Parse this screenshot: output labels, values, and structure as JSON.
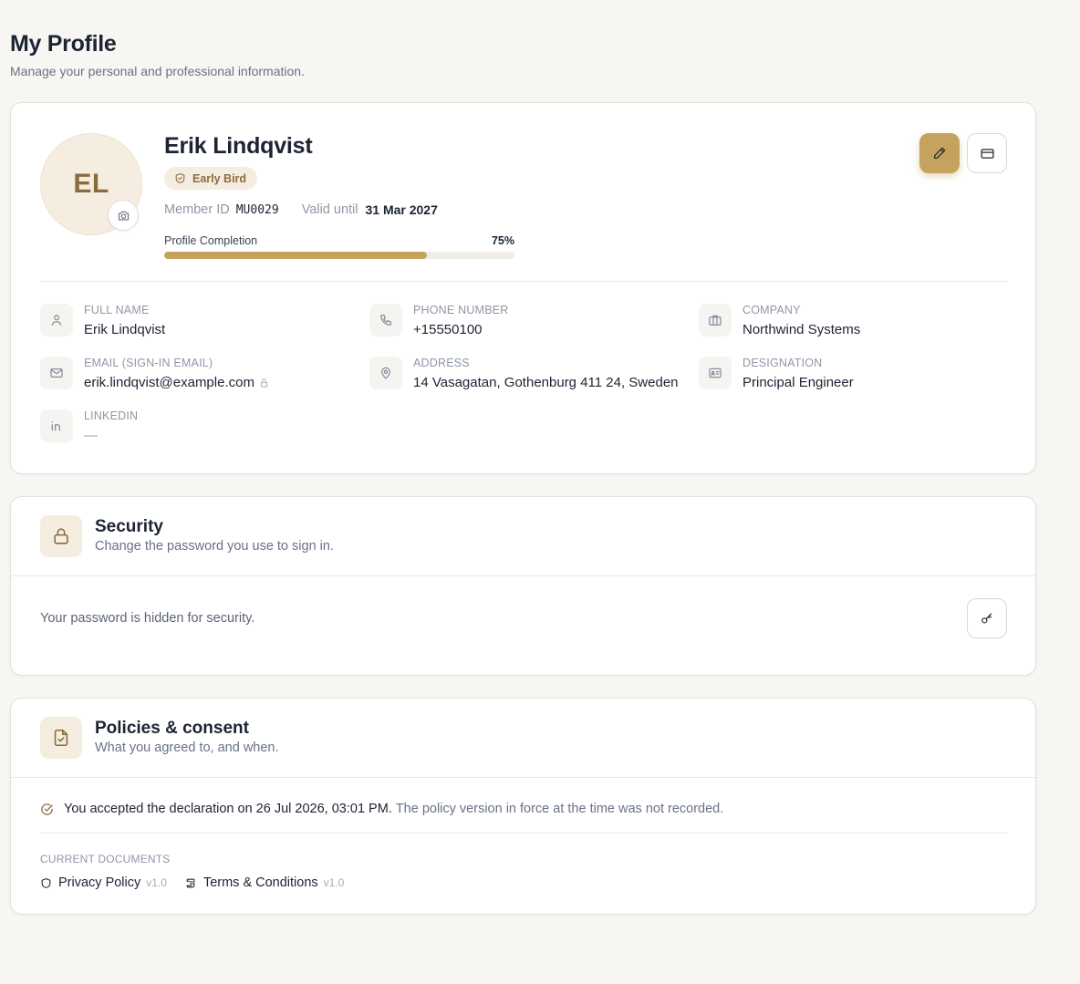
{
  "page": {
    "title": "My Profile",
    "subtitle": "Manage your personal and professional information."
  },
  "profile": {
    "initials": "EL",
    "name": "Erik Lindqvist",
    "badge": "Early Bird",
    "member_id_label": "Member ID",
    "member_id": "MU0029",
    "valid_until_label": "Valid until",
    "valid_until": "31 Mar 2027",
    "completion_label": "Profile Completion",
    "completion_text": "75%",
    "completion_value": 0.75,
    "fields": {
      "full_name": {
        "label": "FULL NAME",
        "value": "Erik Lindqvist"
      },
      "phone": {
        "label": "PHONE NUMBER",
        "value": "+15550100"
      },
      "company": {
        "label": "COMPANY",
        "value": "Northwind Systems"
      },
      "email": {
        "label": "EMAIL (SIGN-IN EMAIL)",
        "value": "erik.lindqvist@example.com"
      },
      "address": {
        "label": "ADDRESS",
        "value": "14 Vasagatan, Gothenburg 411 24, Sweden"
      },
      "designation": {
        "label": "DESIGNATION",
        "value": "Principal Engineer"
      },
      "linkedin": {
        "label": "LINKEDIN",
        "value": "—"
      }
    }
  },
  "security": {
    "title": "Security",
    "subtitle": "Change the password you use to sign in.",
    "password_text": "Your password is hidden for security."
  },
  "policies": {
    "title": "Policies & consent",
    "subtitle": "What you agreed to, and when.",
    "consent_main": "You accepted the declaration on 26 Jul 2026, 03:01 PM.",
    "consent_note": "The policy version in force at the time was not recorded.",
    "docs_label": "CURRENT DOCUMENTS",
    "documents": [
      {
        "name": "Privacy Policy",
        "version": "v1.0"
      },
      {
        "name": "Terms & Conditions",
        "version": "v1.0"
      }
    ]
  },
  "colors": {
    "accent": "#c5a35f",
    "accent_dark": "#8b6b3e",
    "accent_soft": "#f5ede0",
    "text": "#1c2333",
    "muted": "#8f97a6"
  },
  "icons": [
    "camera-icon",
    "shield-check-icon",
    "pencil-icon",
    "credit-card-icon",
    "user-icon",
    "phone-icon",
    "briefcase-icon",
    "mail-icon",
    "map-pin-icon",
    "id-card-icon",
    "linkedin-icon",
    "lock-icon",
    "file-check-icon",
    "key-icon",
    "circle-check-icon",
    "shield-icon",
    "scroll-icon"
  ]
}
